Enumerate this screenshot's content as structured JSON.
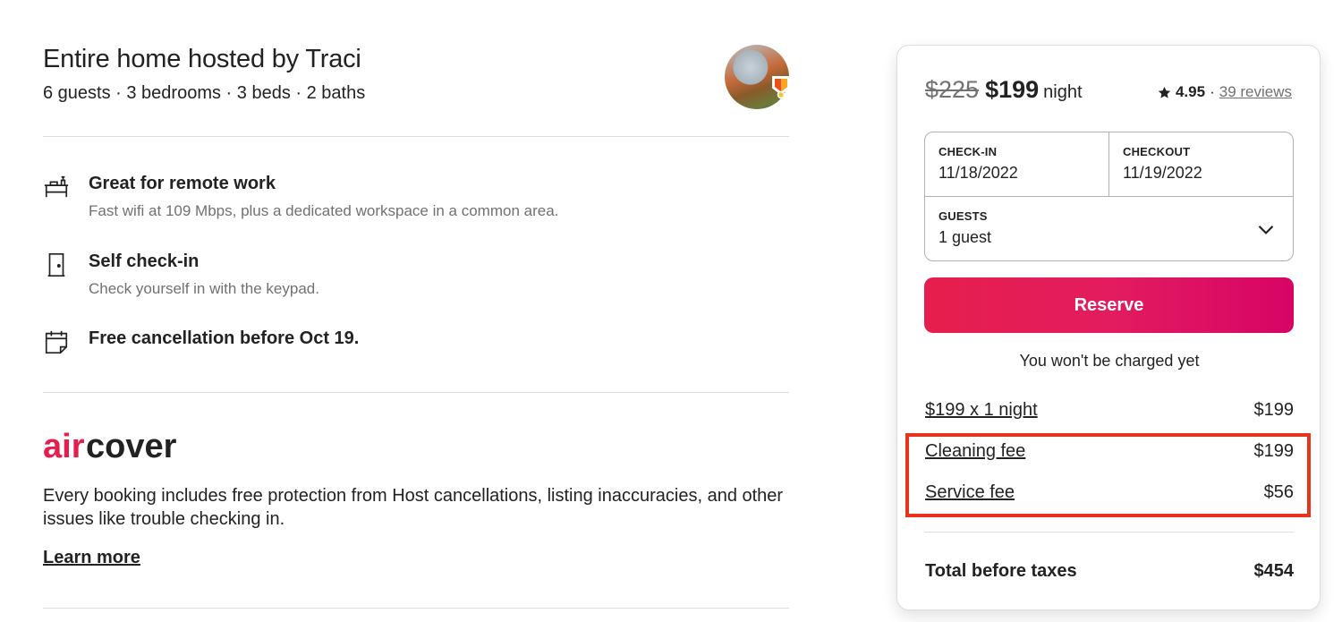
{
  "listing": {
    "title": "Entire home hosted by Traci",
    "subtitle": "6 guests · 3 bedrooms · 3 beds · 2 baths"
  },
  "features": [
    {
      "icon": "desk-icon",
      "title": "Great for remote work",
      "description": "Fast wifi at 109 Mbps, plus a dedicated workspace in a common area."
    },
    {
      "icon": "door-icon",
      "title": "Self check-in",
      "description": "Check yourself in with the keypad."
    },
    {
      "icon": "calendar-icon",
      "title": "Free cancellation before Oct 19.",
      "description": ""
    }
  ],
  "aircover": {
    "logo_air": "air",
    "logo_cover": "cover",
    "text": "Every booking includes free protection from Host cancellations, listing inaccuracies, and other issues like trouble checking in.",
    "learn_more": "Learn more"
  },
  "booking": {
    "original_price": "$225",
    "price": "$199",
    "per": "night",
    "rating": "4.95",
    "separator": "·",
    "reviews": "39 reviews",
    "checkin_label": "CHECK-IN",
    "checkin_value": "11/18/2022",
    "checkout_label": "CHECKOUT",
    "checkout_value": "11/19/2022",
    "guests_label": "GUESTS",
    "guests_value": "1 guest",
    "reserve_label": "Reserve",
    "no_charge": "You won't be charged yet",
    "fees": [
      {
        "label": "$199 x 1 night",
        "amount": "$199"
      },
      {
        "label": "Cleaning fee",
        "amount": "$199"
      },
      {
        "label": "Service fee",
        "amount": "$56"
      }
    ],
    "total_label": "Total before taxes",
    "total_amount": "$454"
  },
  "colors": {
    "brand": "#e61e4d",
    "highlight": "#e8341c",
    "text": "#222222",
    "muted": "#717171"
  }
}
